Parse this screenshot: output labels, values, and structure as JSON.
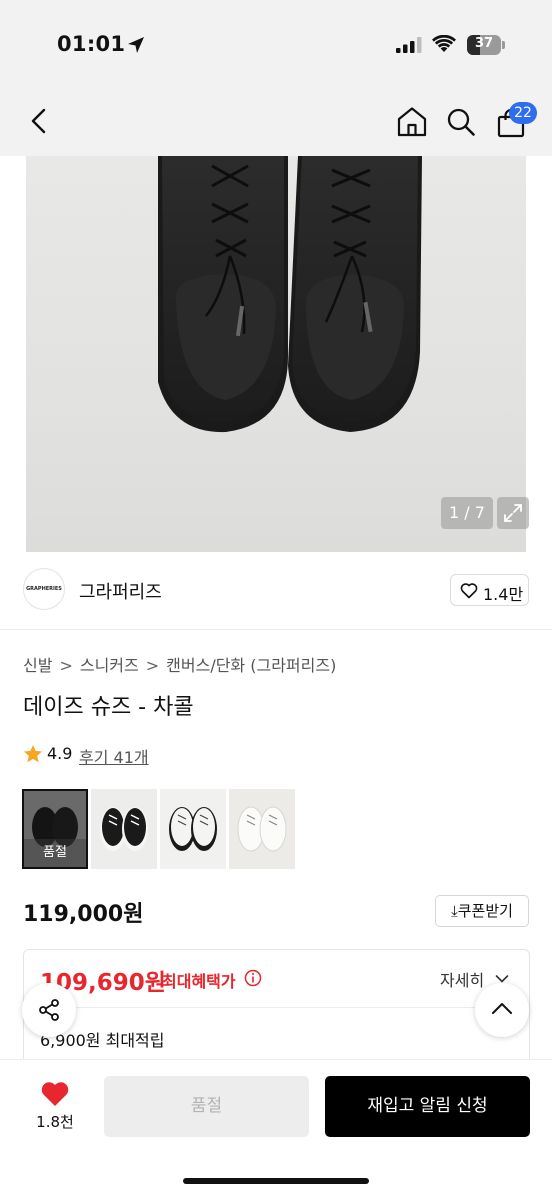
{
  "status_bar": {
    "time": "01:01",
    "battery": "37",
    "battery_level": 0.37
  },
  "nav": {
    "cart_count": "22"
  },
  "hero": {
    "counter": "1 / 7"
  },
  "brand": {
    "logo_text": "GRAPHERIES",
    "name": "그라퍼리즈",
    "like_count": "1.4만"
  },
  "breadcrumb": [
    "신발",
    "스니커즈",
    "캔버스/단화 (그라퍼리즈)"
  ],
  "product": {
    "title": "데이즈 슈즈 - 차콜",
    "rating": "4.9",
    "review_link": "후기 41개",
    "price": "119,000원",
    "coupon_label": "쿠폰받기"
  },
  "thumbnails": [
    {
      "label": "품절",
      "variant": "charcoal"
    },
    {
      "label": "",
      "variant": "black-white-sole"
    },
    {
      "label": "",
      "variant": "white-black-sole"
    },
    {
      "label": "",
      "variant": "white"
    }
  ],
  "benefit": {
    "price": "109,690원",
    "label": "최대혜택가",
    "detail_label": "자세히",
    "point_text": "6,900원 최대적립"
  },
  "bottom_bar": {
    "wish_count": "1.8천",
    "soldout_label": "품절",
    "restock_label": "재입고 알림 신청"
  },
  "colors": {
    "accent_red": "#e8262d",
    "badge_blue": "#2f6df0",
    "heart_red": "#e8262d"
  }
}
